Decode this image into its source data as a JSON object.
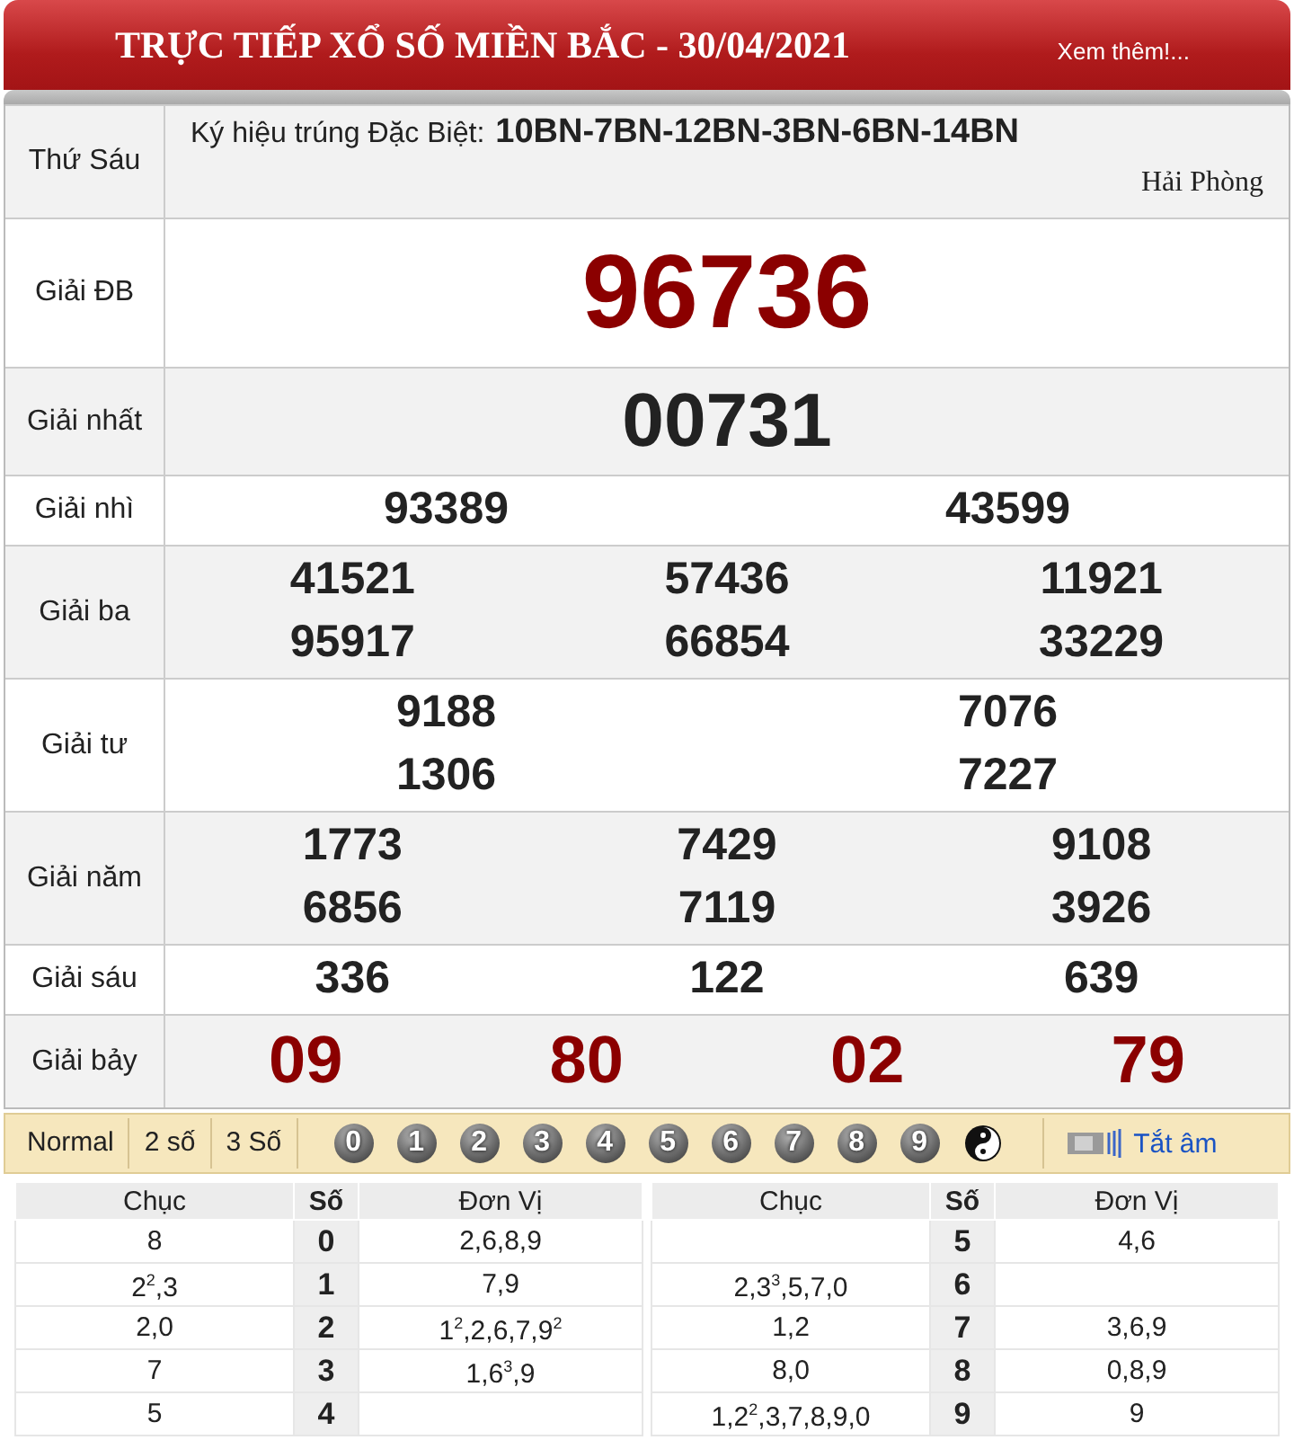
{
  "header": {
    "title": "TRỰC TIẾP XỔ SỐ MIỀN BẮC - 30/04/2021",
    "more_link": "Xem thêm!..."
  },
  "info": {
    "label": "Thứ Sáu",
    "symbols_label": "Ký hiệu trúng Đặc Biệt:",
    "symbols": "10BN-7BN-12BN-3BN-6BN-14BN",
    "province": "Hải Phòng"
  },
  "prizes": [
    {
      "label": "Giải ĐB",
      "kind": "special",
      "numbers": [
        "96736"
      ]
    },
    {
      "label": "Giải nhất",
      "kind": "first",
      "numbers": [
        "00731"
      ]
    },
    {
      "label": "Giải nhì",
      "kind": "two-col",
      "numbers": [
        "93389",
        "43599"
      ]
    },
    {
      "label": "Giải ba",
      "kind": "three-col",
      "numbers": [
        "41521",
        "57436",
        "11921",
        "95917",
        "66854",
        "33229"
      ]
    },
    {
      "label": "Giải tư",
      "kind": "two-col",
      "numbers": [
        "9188",
        "7076",
        "1306",
        "7227"
      ]
    },
    {
      "label": "Giải năm",
      "kind": "three-col",
      "numbers": [
        "1773",
        "7429",
        "9108",
        "6856",
        "7119",
        "3926"
      ]
    },
    {
      "label": "Giải sáu",
      "kind": "three-col",
      "numbers": [
        "336",
        "122",
        "639"
      ]
    },
    {
      "label": "Giải bảy",
      "kind": "four-col",
      "numbers": [
        "09",
        "80",
        "02",
        "79"
      ]
    }
  ],
  "toolbar": {
    "modes": [
      "Normal",
      "2 số",
      "3 Số"
    ],
    "digits": [
      "0",
      "1",
      "2",
      "3",
      "4",
      "5",
      "6",
      "7",
      "8",
      "9"
    ],
    "mute_link": "Tắt âm"
  },
  "loto": [
    {
      "columns": [
        "Chục",
        "Số",
        "Đơn Vị"
      ],
      "rows": [
        {
          "tens": "8",
          "head": "0",
          "units": "2,6,8,9"
        },
        {
          "tens": "2$^{2}$,3",
          "head": "1",
          "units": "7,9"
        },
        {
          "tens": "2,0",
          "head": "2",
          "units": "1$^{2}$,2,6,7,9$^{2}$"
        },
        {
          "tens": "7",
          "head": "3",
          "units": "1,6$^{3}$,9"
        },
        {
          "tens": "5",
          "head": "4"
        }
      ]
    },
    {
      "columns": [
        "Chục",
        "Số",
        "Đơn Vị"
      ],
      "rows": [
        {
          "head": "5",
          "units": "4,6"
        },
        {
          "tens": "2,3$^{3}$,5,7,0",
          "head": "6"
        },
        {
          "tens": "1,2",
          "head": "7",
          "units": "3,6,9"
        },
        {
          "tens": "8,0",
          "head": "8",
          "units": "0,8,9"
        },
        {
          "tens": "1,2$^{2}$,3,7,8,9,0",
          "head": "9",
          "units": "9"
        }
      ]
    }
  ]
}
